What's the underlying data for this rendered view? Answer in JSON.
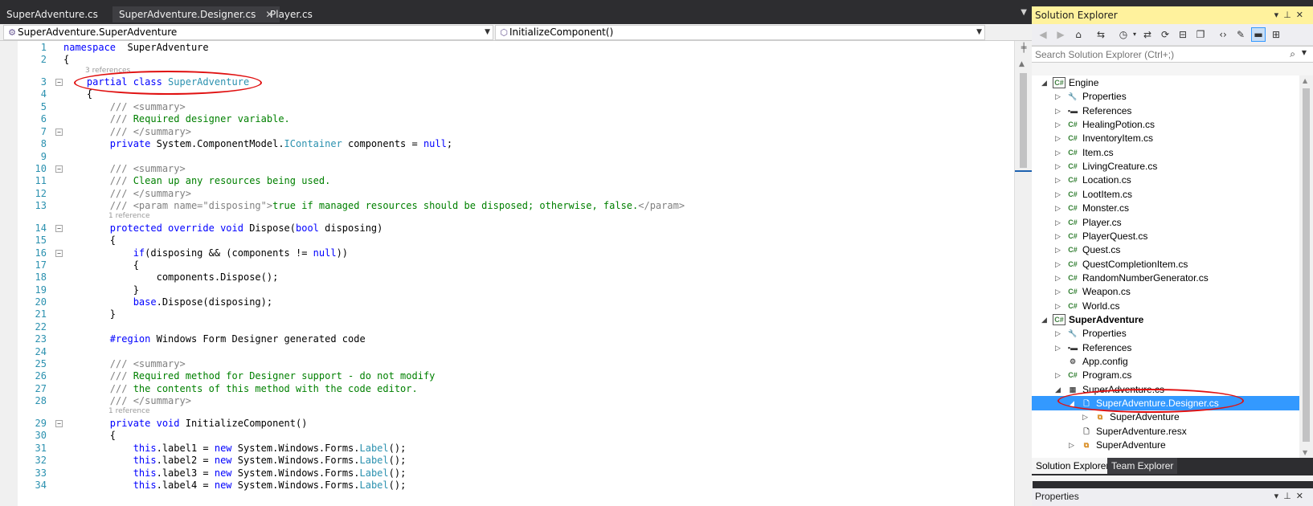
{
  "tabs": [
    {
      "label": "SuperAdventure.cs"
    },
    {
      "label": "SuperAdventure.Designer.cs",
      "close": "✕"
    },
    {
      "label": "Player.cs"
    }
  ],
  "nav": {
    "scope": "SuperAdventure.SuperAdventure",
    "member": "InitializeComponent()"
  },
  "editor": {
    "lines": [
      {
        "n": "1",
        "parts": [
          [
            "kw",
            "namespace"
          ],
          [
            "",
            "  SuperAdventure"
          ]
        ]
      },
      {
        "n": "2",
        "parts": [
          [
            "",
            "{"
          ]
        ]
      },
      {
        "n": "3",
        "parts": [
          [
            "",
            "    "
          ],
          [
            "kw",
            "partial class"
          ],
          [
            "",
            ""
          ],
          [
            "ty",
            " SuperAdventure"
          ]
        ]
      },
      {
        "n": "4",
        "parts": [
          [
            "",
            "    {"
          ]
        ]
      },
      {
        "n": "5",
        "parts": [
          [
            "gx",
            "        /// <summary>"
          ]
        ]
      },
      {
        "n": "6",
        "parts": [
          [
            "gx",
            "        ///"
          ],
          [
            "cm",
            " Required designer variable."
          ]
        ]
      },
      {
        "n": "7",
        "parts": [
          [
            "gx",
            "        /// </summary>"
          ]
        ]
      },
      {
        "n": "8",
        "parts": [
          [
            "",
            "        "
          ],
          [
            "kw",
            "private"
          ],
          [
            "",
            " System.ComponentModel."
          ],
          [
            "ty",
            "IContainer"
          ],
          [
            "",
            " components = "
          ],
          [
            "kw",
            "null"
          ],
          [
            "",
            ";"
          ]
        ]
      },
      {
        "n": "9",
        "parts": [
          [
            "",
            ""
          ]
        ]
      },
      {
        "n": "10",
        "parts": [
          [
            "gx",
            "        /// <summary>"
          ]
        ]
      },
      {
        "n": "11",
        "parts": [
          [
            "gx",
            "        ///"
          ],
          [
            "cm",
            " Clean up any resources being used."
          ]
        ]
      },
      {
        "n": "12",
        "parts": [
          [
            "gx",
            "        /// </summary>"
          ]
        ]
      },
      {
        "n": "13",
        "parts": [
          [
            "gx",
            "        /// <param name=\"disposing\">"
          ],
          [
            "cm",
            "true if managed resources should be disposed; otherwise, false."
          ],
          [
            "gx",
            "</param>"
          ]
        ]
      },
      {
        "n": "14",
        "parts": [
          [
            "",
            "        "
          ],
          [
            "kw",
            "protected override void"
          ],
          [
            "",
            " Dispose("
          ],
          [
            "kw",
            "bool"
          ],
          [
            "",
            " disposing)"
          ]
        ]
      },
      {
        "n": "15",
        "parts": [
          [
            "",
            "        {"
          ]
        ]
      },
      {
        "n": "16",
        "parts": [
          [
            "",
            "            "
          ],
          [
            "kw",
            "if"
          ],
          [
            "",
            "(disposing && (components != "
          ],
          [
            "kw",
            "null"
          ],
          [
            "",
            "))"
          ]
        ]
      },
      {
        "n": "17",
        "parts": [
          [
            "",
            "            {"
          ]
        ]
      },
      {
        "n": "18",
        "parts": [
          [
            "",
            "                components.Dispose();"
          ]
        ]
      },
      {
        "n": "19",
        "parts": [
          [
            "",
            "            }"
          ]
        ]
      },
      {
        "n": "20",
        "parts": [
          [
            "",
            "            "
          ],
          [
            "kw",
            "base"
          ],
          [
            "",
            ".Dispose(disposing);"
          ]
        ]
      },
      {
        "n": "21",
        "parts": [
          [
            "",
            "        }"
          ]
        ]
      },
      {
        "n": "22",
        "parts": [
          [
            "",
            ""
          ]
        ]
      },
      {
        "n": "23",
        "parts": [
          [
            "",
            "        "
          ],
          [
            "kw",
            "#region"
          ],
          [
            "",
            " Windows Form Designer generated code"
          ]
        ]
      },
      {
        "n": "24",
        "parts": [
          [
            "",
            ""
          ]
        ]
      },
      {
        "n": "25",
        "parts": [
          [
            "gx",
            "        /// <summary>"
          ]
        ]
      },
      {
        "n": "26",
        "parts": [
          [
            "gx",
            "        ///"
          ],
          [
            "cm",
            " Required method for Designer support - do not modify"
          ]
        ]
      },
      {
        "n": "27",
        "parts": [
          [
            "gx",
            "        ///"
          ],
          [
            "cm",
            " the contents of this method with the code editor."
          ]
        ]
      },
      {
        "n": "28",
        "parts": [
          [
            "gx",
            "        /// </summary>"
          ]
        ]
      },
      {
        "n": "29",
        "parts": [
          [
            "",
            "        "
          ],
          [
            "kw",
            "private void"
          ],
          [
            "",
            " InitializeComponent()"
          ]
        ]
      },
      {
        "n": "30",
        "parts": [
          [
            "",
            "        {"
          ]
        ]
      },
      {
        "n": "31",
        "parts": [
          [
            "",
            "            "
          ],
          [
            "kw",
            "this"
          ],
          [
            "",
            ".label1 = "
          ],
          [
            "kw",
            "new"
          ],
          [
            "",
            " System.Windows.Forms."
          ],
          [
            "ty",
            "Label"
          ],
          [
            "",
            "();"
          ]
        ]
      },
      {
        "n": "32",
        "parts": [
          [
            "",
            "            "
          ],
          [
            "kw",
            "this"
          ],
          [
            "",
            ".label2 = "
          ],
          [
            "kw",
            "new"
          ],
          [
            "",
            " System.Windows.Forms."
          ],
          [
            "ty",
            "Label"
          ],
          [
            "",
            "();"
          ]
        ]
      },
      {
        "n": "33",
        "parts": [
          [
            "",
            "            "
          ],
          [
            "kw",
            "this"
          ],
          [
            "",
            ".label3 = "
          ],
          [
            "kw",
            "new"
          ],
          [
            "",
            " System.Windows.Forms."
          ],
          [
            "ty",
            "Label"
          ],
          [
            "",
            "();"
          ]
        ]
      },
      {
        "n": "34",
        "parts": [
          [
            "",
            "            "
          ],
          [
            "kw",
            "this"
          ],
          [
            "",
            ".label4 = "
          ],
          [
            "kw",
            "new"
          ],
          [
            "",
            " System.Windows.Forms."
          ],
          [
            "ty",
            "Label"
          ],
          [
            "",
            "();"
          ]
        ]
      }
    ],
    "ref_3": "3 references",
    "ref_14": "1 reference",
    "ref_29": "1 reference"
  },
  "solution_explorer": {
    "title": "Solution Explorer",
    "search_placeholder": "Search Solution Explorer (Ctrl+;)",
    "items": [
      {
        "label": "Engine",
        "level": 0,
        "arrow": "◢",
        "icon": "C#",
        "bold": false
      },
      {
        "label": "Properties",
        "level": 1,
        "arrow": "▷",
        "icon": "wrench"
      },
      {
        "label": "References",
        "level": 1,
        "arrow": "▷",
        "icon": "refs"
      },
      {
        "label": "HealingPotion.cs",
        "level": 1,
        "arrow": "▷",
        "icon": "cs"
      },
      {
        "label": "InventoryItem.cs",
        "level": 1,
        "arrow": "▷",
        "icon": "cs"
      },
      {
        "label": "Item.cs",
        "level": 1,
        "arrow": "▷",
        "icon": "cs"
      },
      {
        "label": "LivingCreature.cs",
        "level": 1,
        "arrow": "▷",
        "icon": "cs"
      },
      {
        "label": "Location.cs",
        "level": 1,
        "arrow": "▷",
        "icon": "cs"
      },
      {
        "label": "LootItem.cs",
        "level": 1,
        "arrow": "▷",
        "icon": "cs"
      },
      {
        "label": "Monster.cs",
        "level": 1,
        "arrow": "▷",
        "icon": "cs"
      },
      {
        "label": "Player.cs",
        "level": 1,
        "arrow": "▷",
        "icon": "cs"
      },
      {
        "label": "PlayerQuest.cs",
        "level": 1,
        "arrow": "▷",
        "icon": "cs"
      },
      {
        "label": "Quest.cs",
        "level": 1,
        "arrow": "▷",
        "icon": "cs"
      },
      {
        "label": "QuestCompletionItem.cs",
        "level": 1,
        "arrow": "▷",
        "icon": "cs"
      },
      {
        "label": "RandomNumberGenerator.cs",
        "level": 1,
        "arrow": "▷",
        "icon": "cs"
      },
      {
        "label": "Weapon.cs",
        "level": 1,
        "arrow": "▷",
        "icon": "cs"
      },
      {
        "label": "World.cs",
        "level": 1,
        "arrow": "▷",
        "icon": "cs"
      },
      {
        "label": "SuperAdventure",
        "level": 0,
        "arrow": "◢",
        "icon": "C#",
        "bold": true
      },
      {
        "label": "Properties",
        "level": 1,
        "arrow": "▷",
        "icon": "wrench"
      },
      {
        "label": "References",
        "level": 1,
        "arrow": "▷",
        "icon": "refs"
      },
      {
        "label": "App.config",
        "level": 1,
        "arrow": "",
        "icon": "config"
      },
      {
        "label": "Program.cs",
        "level": 1,
        "arrow": "▷",
        "icon": "cs"
      },
      {
        "label": "SuperAdventure.cs",
        "level": 1,
        "arrow": "◢",
        "icon": "form"
      },
      {
        "label": "SuperAdventure.Designer.cs",
        "level": 2,
        "arrow": "◢",
        "icon": "file",
        "selected": true
      },
      {
        "label": "SuperAdventure",
        "level": 3,
        "arrow": "▷",
        "icon": "class"
      },
      {
        "label": "SuperAdventure.resx",
        "level": 2,
        "arrow": "",
        "icon": "file"
      },
      {
        "label": "SuperAdventure",
        "level": 2,
        "arrow": "▷",
        "icon": "class"
      }
    ],
    "tabs": [
      {
        "label": "Solution Explorer"
      },
      {
        "label": "Team Explorer"
      }
    ]
  },
  "properties": {
    "title": "Properties"
  },
  "colors": {
    "title_highlight": "#fff29d",
    "selection": "#3399ff",
    "annotation": "#e01010"
  }
}
